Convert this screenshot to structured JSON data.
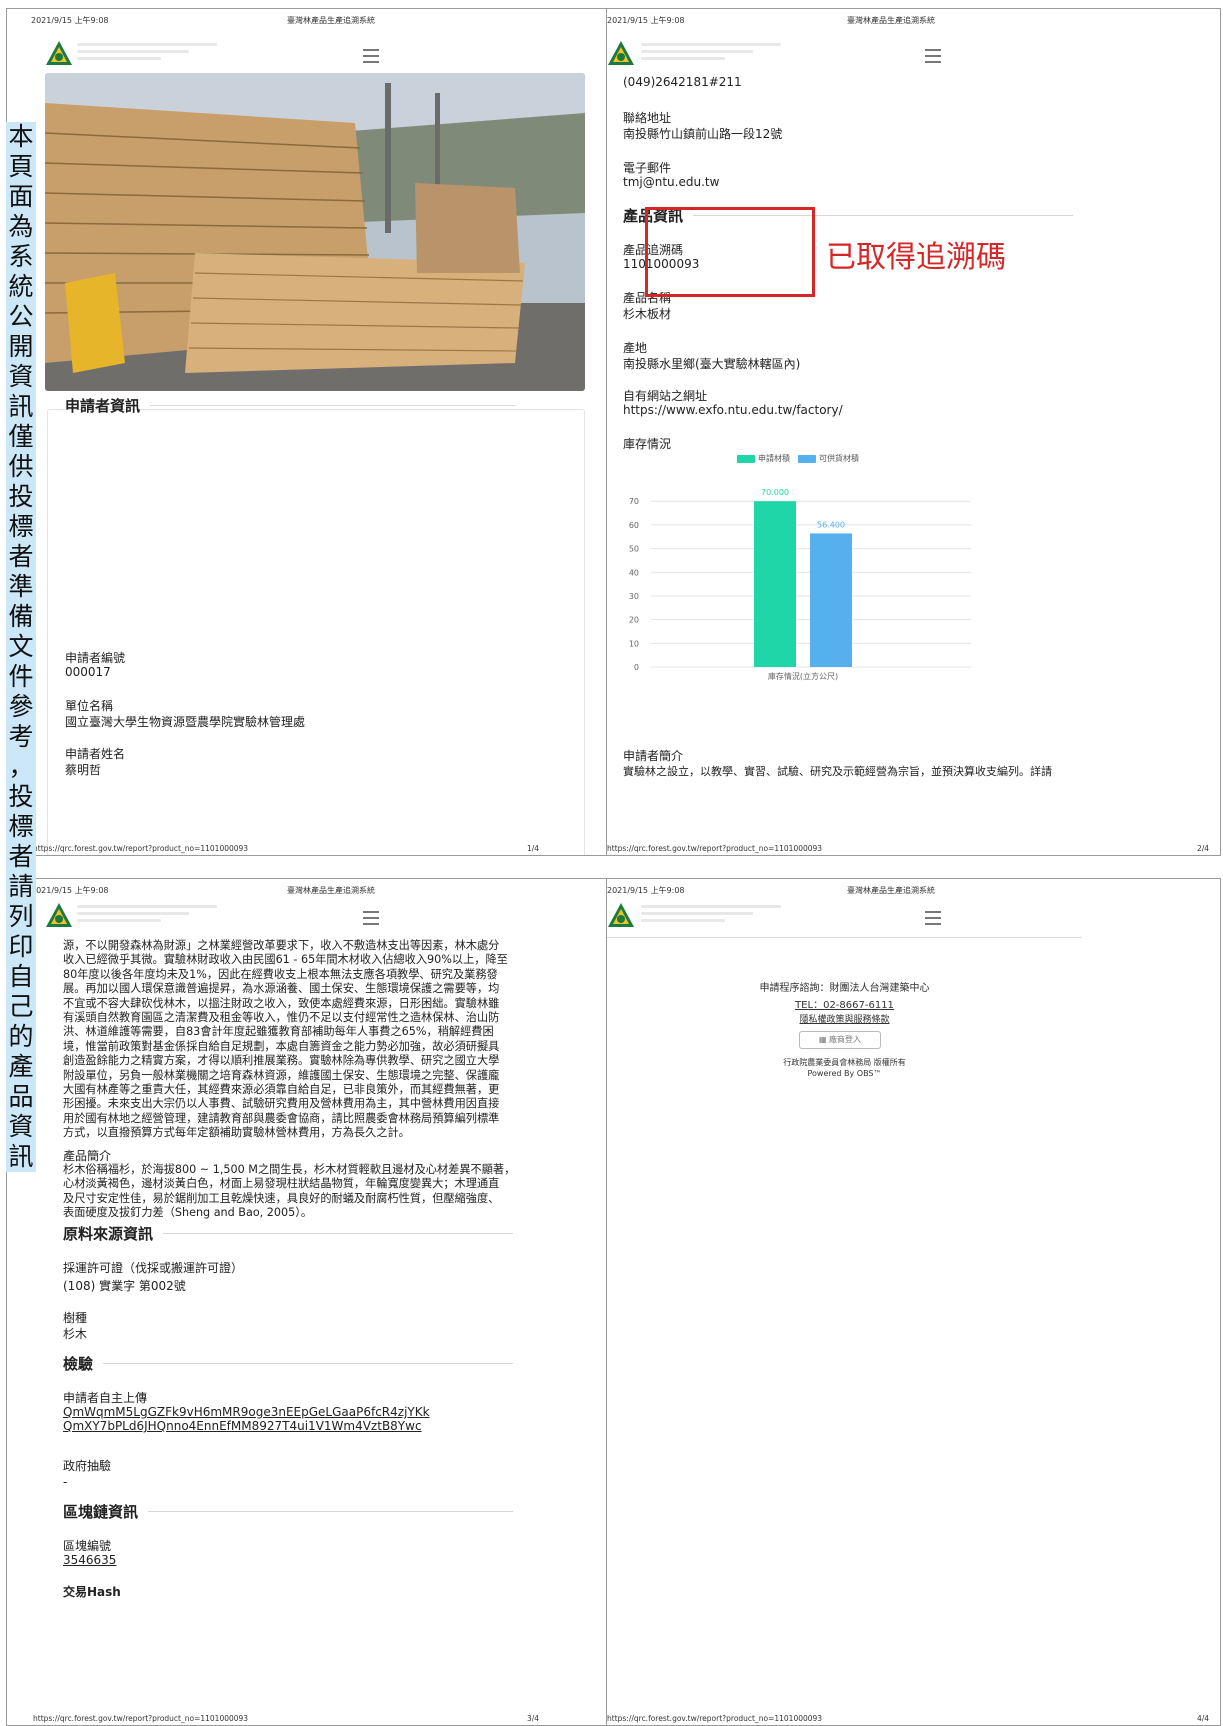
{
  "print_header": {
    "date": "2021/9/15 上午9:08",
    "site_title": "臺灣林產品生產追溯系統"
  },
  "print_footer": {
    "url": "https://qrc.forest.gov.tw/report?product_no=1101000093",
    "pages": [
      "1/4",
      "2/4",
      "3/4",
      "4/4"
    ]
  },
  "annotation": {
    "vertical_note": [
      "本",
      "頁",
      "面",
      "為",
      "系",
      "統",
      "公",
      "開",
      "資",
      "訊",
      "僅",
      "供",
      "投",
      "標",
      "者",
      "準",
      "備",
      "文",
      "件",
      "參",
      "考",
      "，",
      "投",
      "標",
      "者",
      "請",
      "列",
      "印",
      "自",
      "己",
      "的",
      "產",
      "品",
      "資",
      "訊"
    ],
    "callout": "已取得追溯碼"
  },
  "page1": {
    "applicant_section": "申請者資訊",
    "applicant_no_label": "申請者編號",
    "applicant_no": "000017",
    "unit_label": "單位名稱",
    "unit": "國立臺灣大學生物資源暨農學院實驗林管理處",
    "applicant_name_label": "申請者姓名",
    "applicant_name": "蔡明哲"
  },
  "page2": {
    "phone": "(049)2642181#211",
    "address_label": "聯絡地址",
    "address": "南投縣竹山鎮前山路一段12號",
    "email_label": "電子郵件",
    "email": "tmj@ntu.edu.tw",
    "product_section": "產品資訊",
    "trace_code_label": "產品追溯碼",
    "trace_code": "1101000093",
    "product_name_label": "產品名稱",
    "product_name": "杉木板材",
    "origin_label": "產地",
    "origin": "南投縣水里鄉(臺大實驗林轄區內)",
    "website_label": "自有網站之網址",
    "website": "https://www.exfo.ntu.edu.tw/factory/",
    "inventory_label": "庫存情況",
    "intro_label": "申請者簡介",
    "intro_text": "實驗林之設立，以教學、實習、試驗、研究及示範經營為宗旨，並預決算收支編列。詳請"
  },
  "chart_data": {
    "type": "bar",
    "categories": [
      "庫存情況(立方公尺)"
    ],
    "series": [
      {
        "name": "申請材積",
        "values": [
          70.0
        ],
        "label": "70.000",
        "color": "#1fd6a8"
      },
      {
        "name": "可供貨材積",
        "values": [
          56.4
        ],
        "label": "56.400",
        "color": "#56b0ee"
      }
    ],
    "y_ticks": [
      "0",
      "10",
      "20",
      "30",
      "40",
      "50",
      "60",
      "70"
    ],
    "ylim": [
      0,
      76
    ],
    "xlabel": "庫存情況(立方公尺)",
    "legend": "top-center",
    "grid": true
  },
  "page3": {
    "intro_lines": [
      "源，不以開發森林為財源」之林業經營改革要求下，收入不敷造林支出等因素，林木處分",
      "收入已經微乎其微。實驗林財政收入由民國61 - 65年間木材收入佔總收入90%以上，降至",
      "80年度以後各年度均未及1%，因此在經費收支上根本無法支應各項教學、研究及業務發",
      "展。再加以國人環保意識普遍提昇，為水源涵養、國土保安、生態環境保護之需要等，均",
      "不宜或不容大肆砍伐林木，以搵注財政之收入，致使本處經費來源，日形困絀。實驗林雖",
      "有溪頭自然教育園區之清潔費及租金等收入，惟仍不足以支付經常性之造林保林、治山防",
      "洪、林道維護等需要，自83會計年度起雖獲教育部補助每年人事費之65%，稍解經費困",
      "境，惟當前政策對基金係採自給自足規劃，本處自籌資金之能力勢必加強，故必須研擬具",
      "創造盈餘能力之精實方案，才得以順利推展業務。實驗林除為專供教學、研究之國立大學",
      "附設單位，另負一般林業機關之培育森林資源，維護國土保安、生態環境之完整、保護龐",
      "大國有林產等之重責大任，其經費來源必須靠自給自足，已非良策外，而其經費無著，更",
      "形困擾。未來支出大宗仍以人事費、試驗研究費用及營林費用為主，其中營林費用因直接",
      "用於國有林地之經營管理，建請教育部與農委會協商，請比照農委會林務局預算編列標準",
      "方式，以直撥預算方式每年定額補助實驗林營林費用，方為長久之計。"
    ],
    "product_intro_label": "產品簡介",
    "product_intro_lines": [
      "杉木俗稱福杉，於海拔800 ~ 1,500 M之間生長，杉木材質輕軟且邊材及心材差異不顯著，",
      "心材淡黃褐色，邊材淡黃白色，材面上易發現柱狀結晶物質，年輪寬度變異大；木理通直",
      "及尺寸安定性佳，易於鋸削加工且乾燥快速，具良好的耐蟻及耐腐朽性質，但壓縮強度、",
      "表面硬度及拔釘力差（Sheng and Bao, 2005）。"
    ],
    "material_section": "原料來源資訊",
    "permit_label": "採運許可證（伐採或搬運許可證）",
    "permit": "(108) 實業字 第002號",
    "species_label": "樹種",
    "species": "杉木",
    "inspection_section": "檢驗",
    "self_upload_label": "申請者自主上傳",
    "upload_link_1": "QmWqmM5LgGZFk9vH6mMR9oge3nEEpGeLGaaP6fcR4zjYKk",
    "upload_link_2": "QmXY7bPLd6JHQnno4EnnEfMM8927T4ui1V1Wm4VztB8Ywc",
    "gov_sampling_label": "政府抽驗",
    "gov_sampling": "-",
    "blockchain_section": "區塊鏈資訊",
    "block_no_label": "區塊編號",
    "block_no": "3546635",
    "tx_hash_label": "交易Hash"
  },
  "page4": {
    "contact": "申請程序諮詢：財團法人台灣建築中心",
    "tel": "TEL：02-8667-6111",
    "privacy": "隱私權政策與服務條款",
    "login_button": "廠商登入",
    "copyright": "行政院農業委員會林務局 版權所有",
    "powered": "Powered By OBS™"
  }
}
